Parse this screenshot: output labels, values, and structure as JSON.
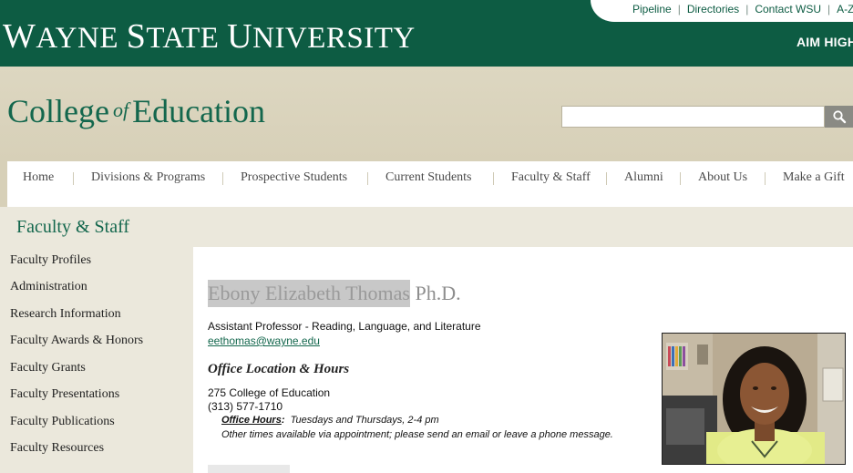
{
  "utility_links": [
    "Pipeline",
    "Directories",
    "Contact WSU",
    "A-Z Ind"
  ],
  "university": {
    "w": "W",
    "ayne": "AYNE ",
    "s": "S",
    "tate": "TATE ",
    "u": "U",
    "niversity": "NIVERSITY"
  },
  "tagline": "AIM HIGH",
  "college": {
    "part1": "College",
    "of": "of",
    "part2": "Education"
  },
  "search": {
    "placeholder": "",
    "value": ""
  },
  "nav": [
    "Home",
    "Divisions & Programs",
    "Prospective Students",
    "Current Students",
    "Faculty & Staff",
    "Alumni",
    "About Us",
    "Make a Gift"
  ],
  "section_title": "Faculty & Staff",
  "sidebar": [
    "Faculty Profiles",
    "Administration",
    "Research Information",
    "Faculty Awards & Honors",
    "Faculty Grants",
    "Faculty Presentations",
    "Faculty Publications",
    "Faculty Resources"
  ],
  "profile": {
    "name": "Ebony Elizabeth Thomas",
    "degree": "Ph.D.",
    "title": "Assistant Professor - Reading, Language, and Literature",
    "email": "eethomas@wayne.edu",
    "office_heading": "Office Location & Hours",
    "address1": "275 College of Education",
    "phone": "(313) 577-1710",
    "hours_label": "Office Hours",
    "hours_value": "Tuesdays and Thursdays, 2-4 pm",
    "other_times": "Other times available via appointment; please send an email or leave a phone message."
  },
  "colors": {
    "brand_green": "#0d5c43",
    "tan": "#d7d0b8",
    "light_tan": "#ebe8dc"
  }
}
